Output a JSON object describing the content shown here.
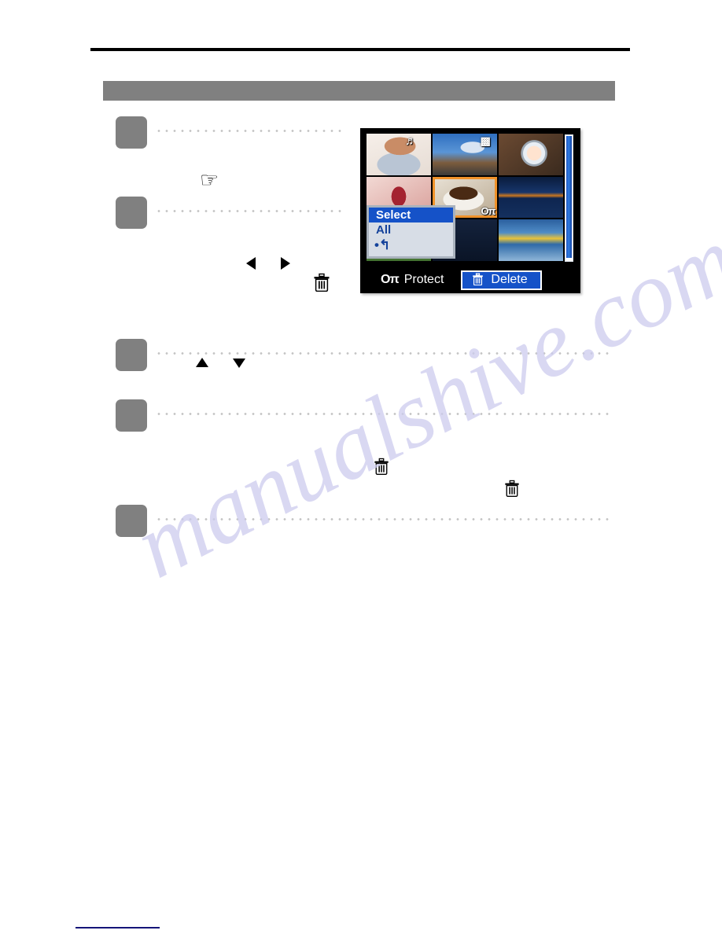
{
  "page": {
    "background_color": "#ffffff",
    "rule_color": "#000000",
    "banner_color": "#808080",
    "watermark_text": "manualshive.com",
    "watermark_color": "#cdccee",
    "bottom_link_color": "#141478"
  },
  "steps": [
    {
      "marker": "",
      "name": "step-1"
    },
    {
      "marker": "",
      "name": "step-2"
    },
    {
      "marker": "",
      "name": "step-3"
    },
    {
      "marker": "",
      "name": "step-4"
    },
    {
      "marker": "",
      "name": "step-5"
    }
  ],
  "inline_icons": {
    "hand": "☞",
    "arrow_left": "◀",
    "arrow_right": "▶",
    "arrow_up": "▲",
    "arrow_down": "▼",
    "trash": "trash-icon"
  },
  "lcd": {
    "frame_color": "#000000",
    "selection_color": "#F0922A",
    "highlight_color": "#1552c8",
    "thumbnails": [
      {
        "name": "thumb-baby",
        "art": "t-baby",
        "badge": "voice-memo",
        "badge_glyph": "♪",
        "selected": false
      },
      {
        "name": "thumb-tree",
        "art": "t-tree",
        "badge": "movie",
        "badge_glyph": "▭",
        "selected": false
      },
      {
        "name": "thumb-porthole",
        "art": "t-porthole",
        "badge": "",
        "badge_glyph": "",
        "selected": false
      },
      {
        "name": "thumb-microphone",
        "art": "t-mic",
        "badge": "",
        "badge_glyph": "",
        "selected": false
      },
      {
        "name": "thumb-coffee-cup",
        "art": "t-cup",
        "badge": "protect",
        "badge_glyph": "Oπ",
        "selected": true
      },
      {
        "name": "thumb-city-night",
        "art": "t-city",
        "badge": "",
        "badge_glyph": "",
        "selected": false
      },
      {
        "name": "thumb-sailboat",
        "art": "t-sail",
        "badge": "",
        "badge_glyph": "",
        "selected": false
      },
      {
        "name": "thumb-blank",
        "art": "t-blank",
        "badge": "",
        "badge_glyph": "",
        "selected": false
      },
      {
        "name": "thumb-boat-ride",
        "art": "t-boat",
        "badge": "",
        "badge_glyph": "",
        "selected": false
      }
    ],
    "popup_menu": {
      "items": [
        {
          "label": "Select",
          "selected": true
        },
        {
          "label": "All",
          "selected": false
        }
      ],
      "return_glyph": "•↰"
    },
    "status_bar": {
      "protect_icon": "Oπ",
      "protect_label": "Protect",
      "delete_icon": "trash-icon",
      "delete_label": "Delete",
      "delete_active": true
    },
    "scrollbar": {
      "position": "right",
      "thumb_color": "#2f7de0"
    }
  }
}
